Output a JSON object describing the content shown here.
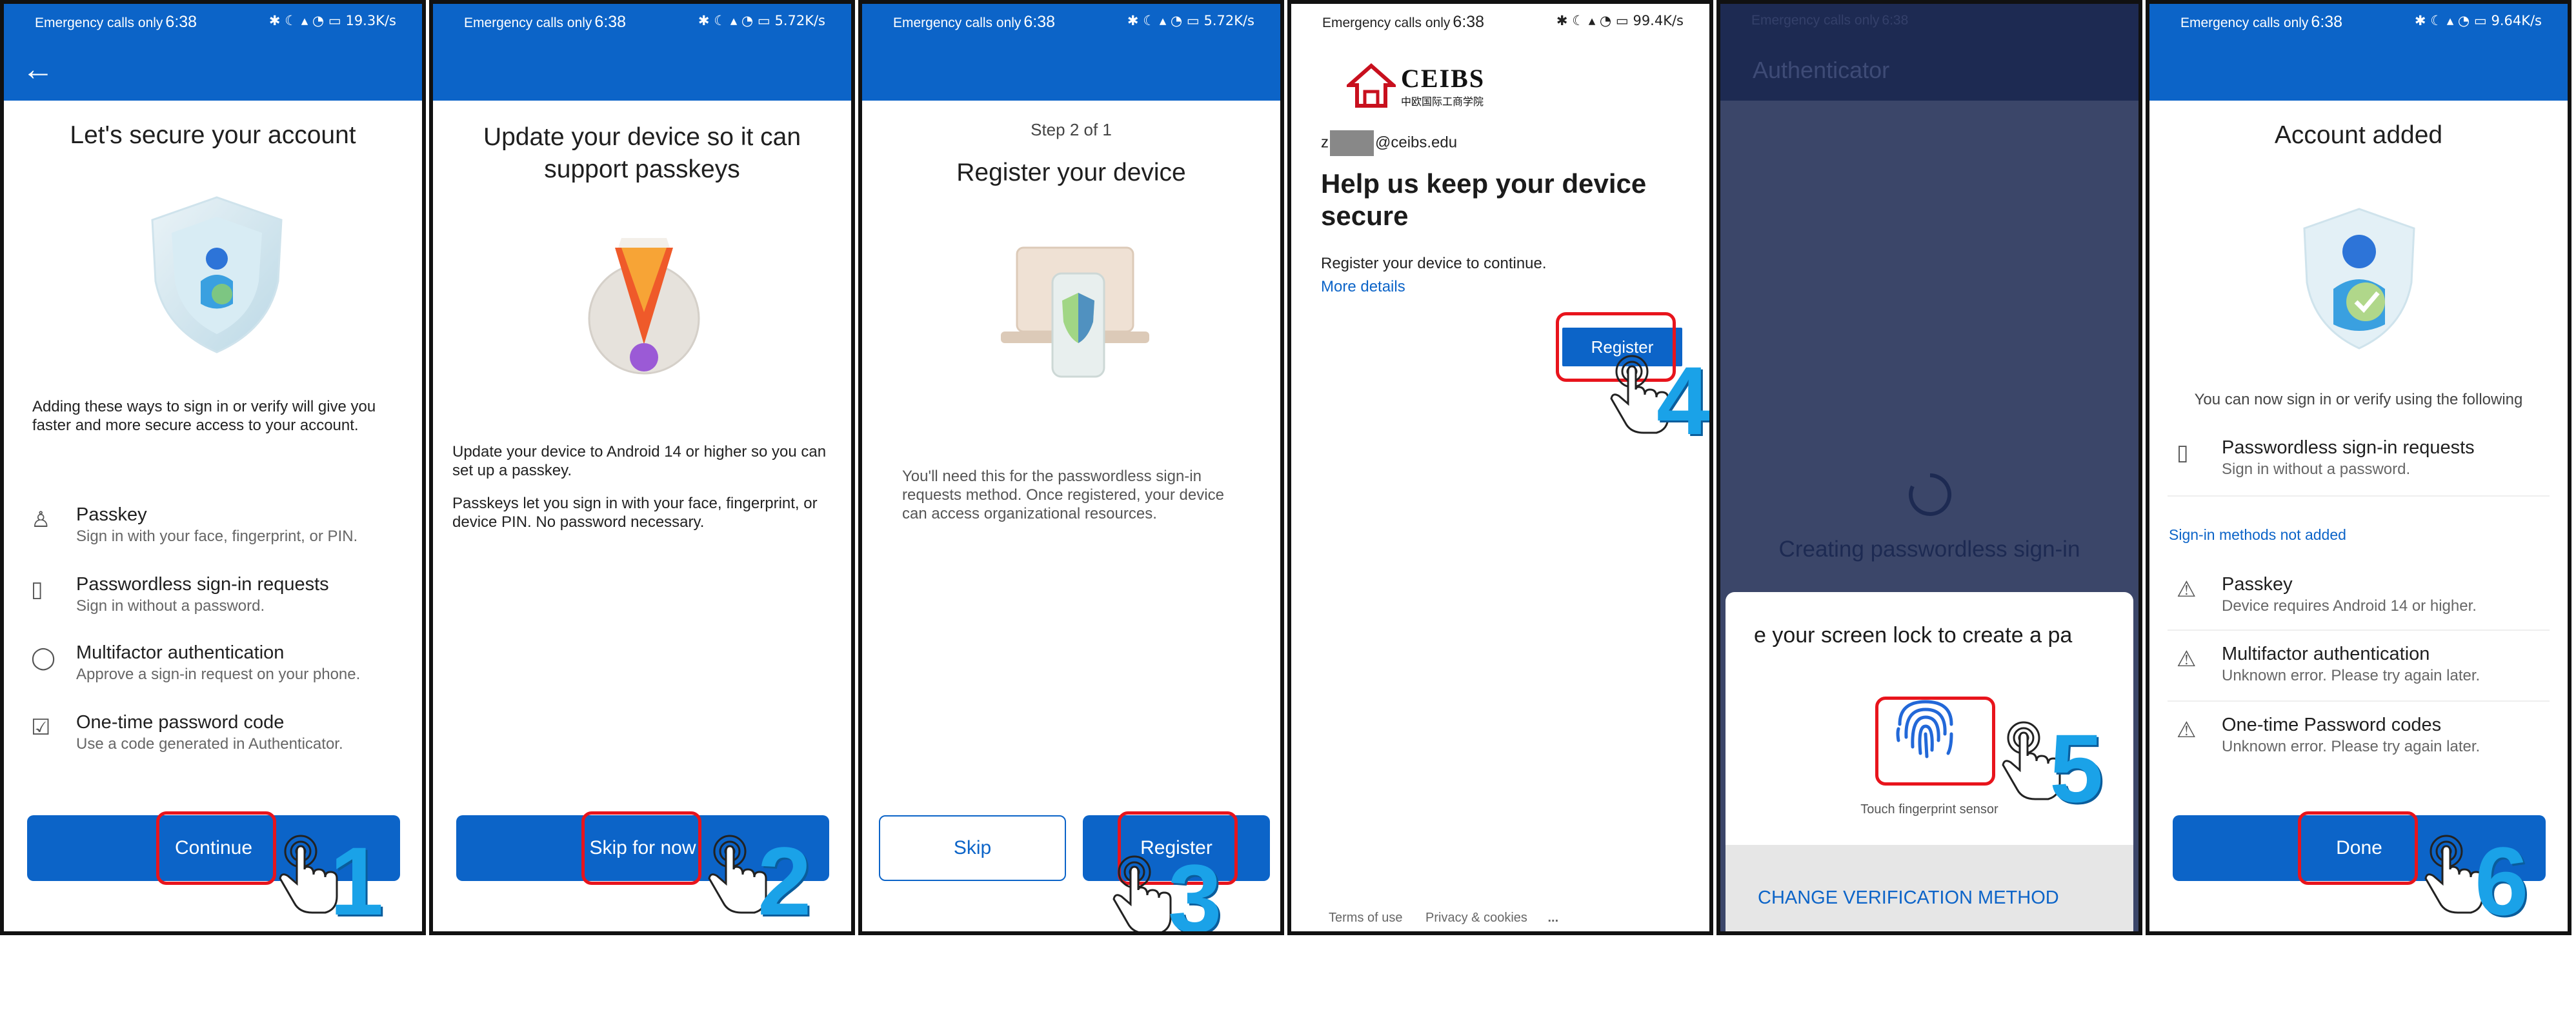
{
  "status": {
    "left_text": "Emergency calls only",
    "time": "6:38",
    "speeds": [
      "19.3K/s",
      "5.72K/s",
      "5.72K/s",
      "99.4K/s",
      "",
      "9.64K/s"
    ],
    "icons": "✱ ☾ ▴ ◔ ▭"
  },
  "p1": {
    "title": "Let's secure your account",
    "desc": "Adding these ways to sign in or verify will give you faster and more secure access to your account.",
    "items": [
      {
        "title": "Passkey",
        "sub": "Sign in with your face, fingerprint, or PIN.",
        "icon": "person-key-icon"
      },
      {
        "title": "Passwordless sign-in requests",
        "sub": "Sign in without a password.",
        "icon": "phone-icon"
      },
      {
        "title": "Multifactor authentication",
        "sub": "Approve a sign-in request on your phone.",
        "icon": "check-shield-icon"
      },
      {
        "title": "One-time password code",
        "sub": "Use a code generated in Authenticator.",
        "icon": "code-check-icon"
      }
    ],
    "button": "Continue",
    "step": "1"
  },
  "p2": {
    "title": "Update your device so it can support passkeys",
    "desc1": "Update your device to Android 14 or higher so you can set up a passkey.",
    "desc2": "Passkeys let you sign in with your face, fingerprint, or device PIN. No password necessary.",
    "button": "Skip for now",
    "step": "2"
  },
  "p3": {
    "step_label": "Step 2 of 1",
    "title": "Register your device",
    "desc": "You'll need this for the passwordless sign-in requests method. Once registered, your device can access organizational resources.",
    "skip": "Skip",
    "register": "Register",
    "step": "3"
  },
  "p4": {
    "logo_text": "CEIBS",
    "logo_sub": "中欧国际工商学院",
    "email_prefix": "z",
    "email_suffix": "@ceibs.edu",
    "title": "Help us keep your device secure",
    "desc": "Register your device to continue.",
    "more": "More details",
    "register": "Register",
    "footer": [
      "Terms of use",
      "Privacy & cookies",
      "..."
    ],
    "step": "4"
  },
  "p5": {
    "appbar": "Authenticator",
    "creating": "Creating passwordless sign-in",
    "sheet_text": "e your screen lock to create a pa",
    "fingerprint_caption": "Touch fingerprint sensor",
    "change": "CHANGE VERIFICATION METHOD",
    "step": "5"
  },
  "p6": {
    "title": "Account added",
    "desc": "You can now sign in or verify using the following",
    "item_added": {
      "title": "Passwordless sign-in requests",
      "sub": "Sign in without a password."
    },
    "not_added_label": "Sign-in methods not added",
    "items": [
      {
        "title": "Passkey",
        "sub": "Device requires Android 14 or higher."
      },
      {
        "title": "Multifactor authentication",
        "sub": "Unknown error. Please try again later."
      },
      {
        "title": "One-time Password codes",
        "sub": "Unknown error. Please try again later."
      }
    ],
    "button": "Done",
    "step": "6"
  },
  "colors": {
    "accent": "#0c64c8",
    "highlight": "#e8141c",
    "step_number": "#1aa2e8"
  }
}
